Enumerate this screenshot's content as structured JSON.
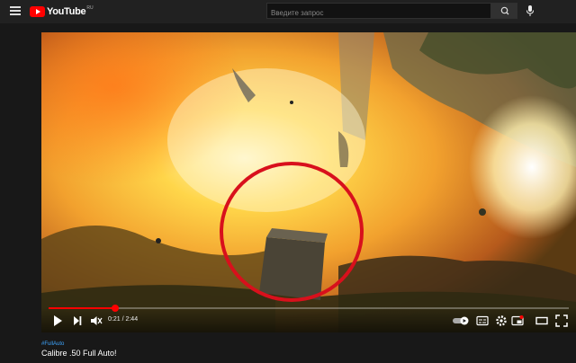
{
  "header": {
    "logo_text": "YouTube",
    "logo_region": "RU",
    "search_placeholder": "Введите запрос"
  },
  "player": {
    "current_time": "0:21",
    "duration": "2:44",
    "time_display": "0:21 / 2:44",
    "progress_fraction": 0.128,
    "annotation_color": "#d8101c",
    "progress_color": "#ff0000"
  },
  "video": {
    "hashtag": "#FullAuto",
    "title": "Calibre .50 Full Auto!"
  },
  "icons": [
    "menu-icon",
    "youtube-logo-icon",
    "search-icon",
    "microphone-icon",
    "play-icon",
    "next-icon",
    "mute-icon",
    "autoplay-toggle-icon",
    "subtitles-icon",
    "settings-icon",
    "miniplayer-icon",
    "theater-icon",
    "fullscreen-icon"
  ]
}
